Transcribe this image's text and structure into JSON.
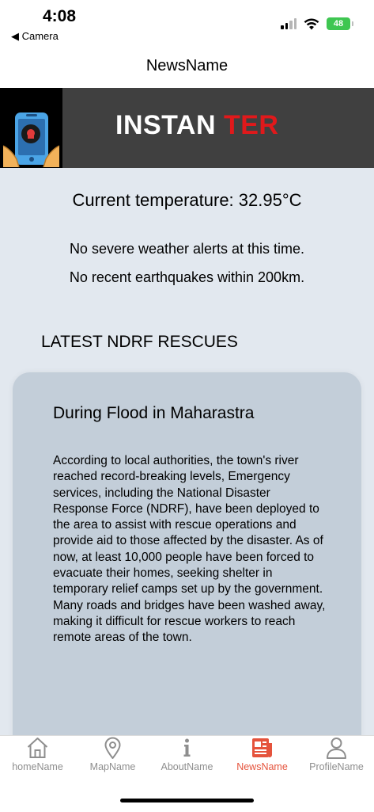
{
  "status_bar": {
    "time": "4:08",
    "back_label": "◀ Camera",
    "battery": "48"
  },
  "header": {
    "title": "NewsName"
  },
  "banner": {
    "title_part1": "INSTAN ",
    "title_part2": "TER"
  },
  "weather": {
    "temperature": "Current temperature: 32.95°C",
    "weather_alert": "No severe weather alerts at this time.",
    "earthquake_alert": "No recent earthquakes within 200km."
  },
  "section": {
    "heading": "LATEST NDRF RESCUES"
  },
  "card": {
    "title": "During Flood in Maharastra",
    "body": "According to local authorities, the town's river reached record-breaking levels, Emergency services, including the National Disaster Response Force (NDRF), have been deployed to the area to assist with rescue operations and provide aid to those affected by the disaster. As of now,  at least 10,000 people have been forced to evacuate their homes, seeking shelter in temporary relief camps set up by the government. Many roads and bridges have been washed away, making it difficult for rescue workers to reach remote areas of the town."
  },
  "tabs": [
    {
      "label": "homeName",
      "icon": "home-icon"
    },
    {
      "label": "MapName",
      "icon": "map-pin-icon"
    },
    {
      "label": "AboutName",
      "icon": "info-icon"
    },
    {
      "label": "NewsName",
      "icon": "newspaper-icon",
      "active": true
    },
    {
      "label": "ProfileName",
      "icon": "profile-icon"
    }
  ],
  "colors": {
    "accent": "#e5533c",
    "banner_red": "#e0191b",
    "banner_bg": "#404040",
    "content_bg": "#e2e8ef",
    "card_bg": "#c3ced9",
    "battery_green": "#3ec651"
  }
}
